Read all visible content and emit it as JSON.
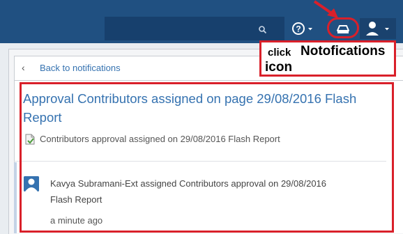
{
  "header": {
    "search_icon": "search-icon",
    "help_icon": "help-icon",
    "notifications_icon": "inbox-icon",
    "user_icon": "user-avatar-icon",
    "bar_color": "#205081"
  },
  "panel": {
    "back_label": "Back to notifications"
  },
  "notification": {
    "title": "Approval Contributors assigned on page 29/08/2016 Flash Report",
    "subtitle": "Contributors approval assigned on 29/08/2016 Flash Report",
    "body": "Kavya Subramani-Ext assigned Contributors approval on 29/08/2016 Flash Report",
    "time": "a minute ago",
    "link_color": "#3572b0"
  },
  "annotation": {
    "click_word": "click",
    "callout_word": "Notofications",
    "icon_word": "icon",
    "highlight_color": "#d9202a"
  }
}
